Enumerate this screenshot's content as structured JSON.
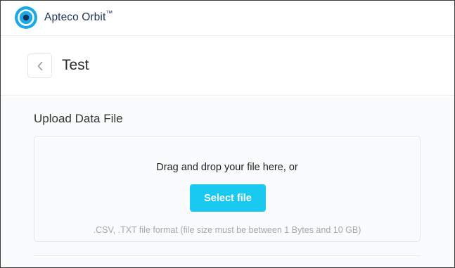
{
  "app": {
    "brand_name": "Apteco Orbit",
    "brand_mark": "™",
    "logo_icon": "orbit-logo-icon",
    "brand_color": "#1e3057",
    "accent_color": "#19c9f0"
  },
  "header": {
    "back_icon": "chevron-left-icon",
    "title": "Test"
  },
  "upload": {
    "section_title": "Upload Data File",
    "drop_text": "Drag and drop your file here, or",
    "select_button_label": "Select file",
    "format_hint": ".CSV, .TXT file format (file size must be between 1 Bytes and 10 GB)"
  }
}
